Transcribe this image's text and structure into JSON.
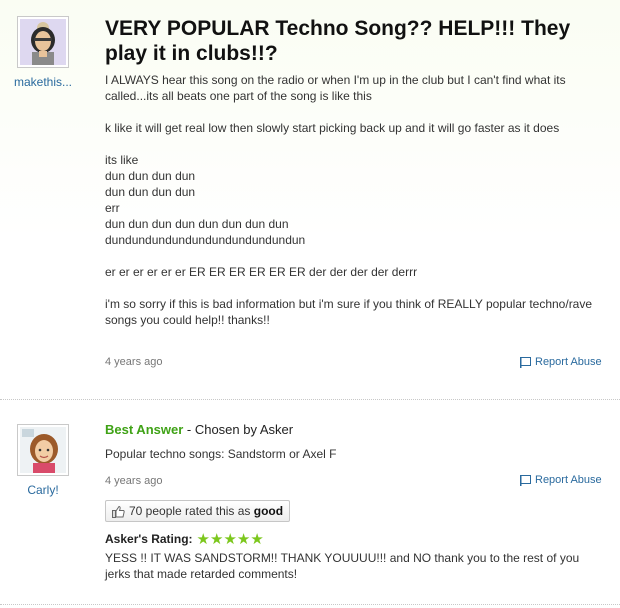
{
  "question": {
    "asker": "makethis...",
    "title": "VERY POPULAR Techno Song?? HELP!!! They play it in clubs!!?",
    "paragraph1": "I ALWAYS hear this song on the radio or when I'm up in the club but I can't find what its called...its all beats one part of the song is like this",
    "paragraph2": "k like it will get real low then slowly start picking back up and it will go faster as it does",
    "lines": [
      "its like",
      "dun dun dun dun",
      "dun dun dun dun",
      "err",
      "dun dun dun dun dun dun dun dun",
      "dundundundundundundundundundun"
    ],
    "paragraph3": "er er er er er er ER ER ER ER ER ER der der der der derrr",
    "paragraph4": "i'm so sorry if this is bad information but i'm sure if you think of REALLY popular techno/rave songs you could help!! thanks!!",
    "time": "4 years ago",
    "report": "Report Abuse"
  },
  "answer": {
    "answerer": "Carly!",
    "best_label": "Best Answer",
    "chosen_by": " - Chosen by Asker",
    "text": "Popular techno songs: Sandstorm or Axel F",
    "time": "4 years ago",
    "report": "Report Abuse",
    "rated_text": "70 people rated this as ",
    "rated_bold": "good",
    "rating_label": "Asker's Rating:",
    "stars": "★★★★★",
    "rating_value": 5,
    "comment": "YESS !! IT WAS SANDSTORM!! THANK YOUUUU!!! and NO thank you to the rest of you jerks that made retarded comments!"
  },
  "colors": {
    "link": "#2a6a9e",
    "best_answer": "#3fa216",
    "stars": "#7cc71d"
  }
}
